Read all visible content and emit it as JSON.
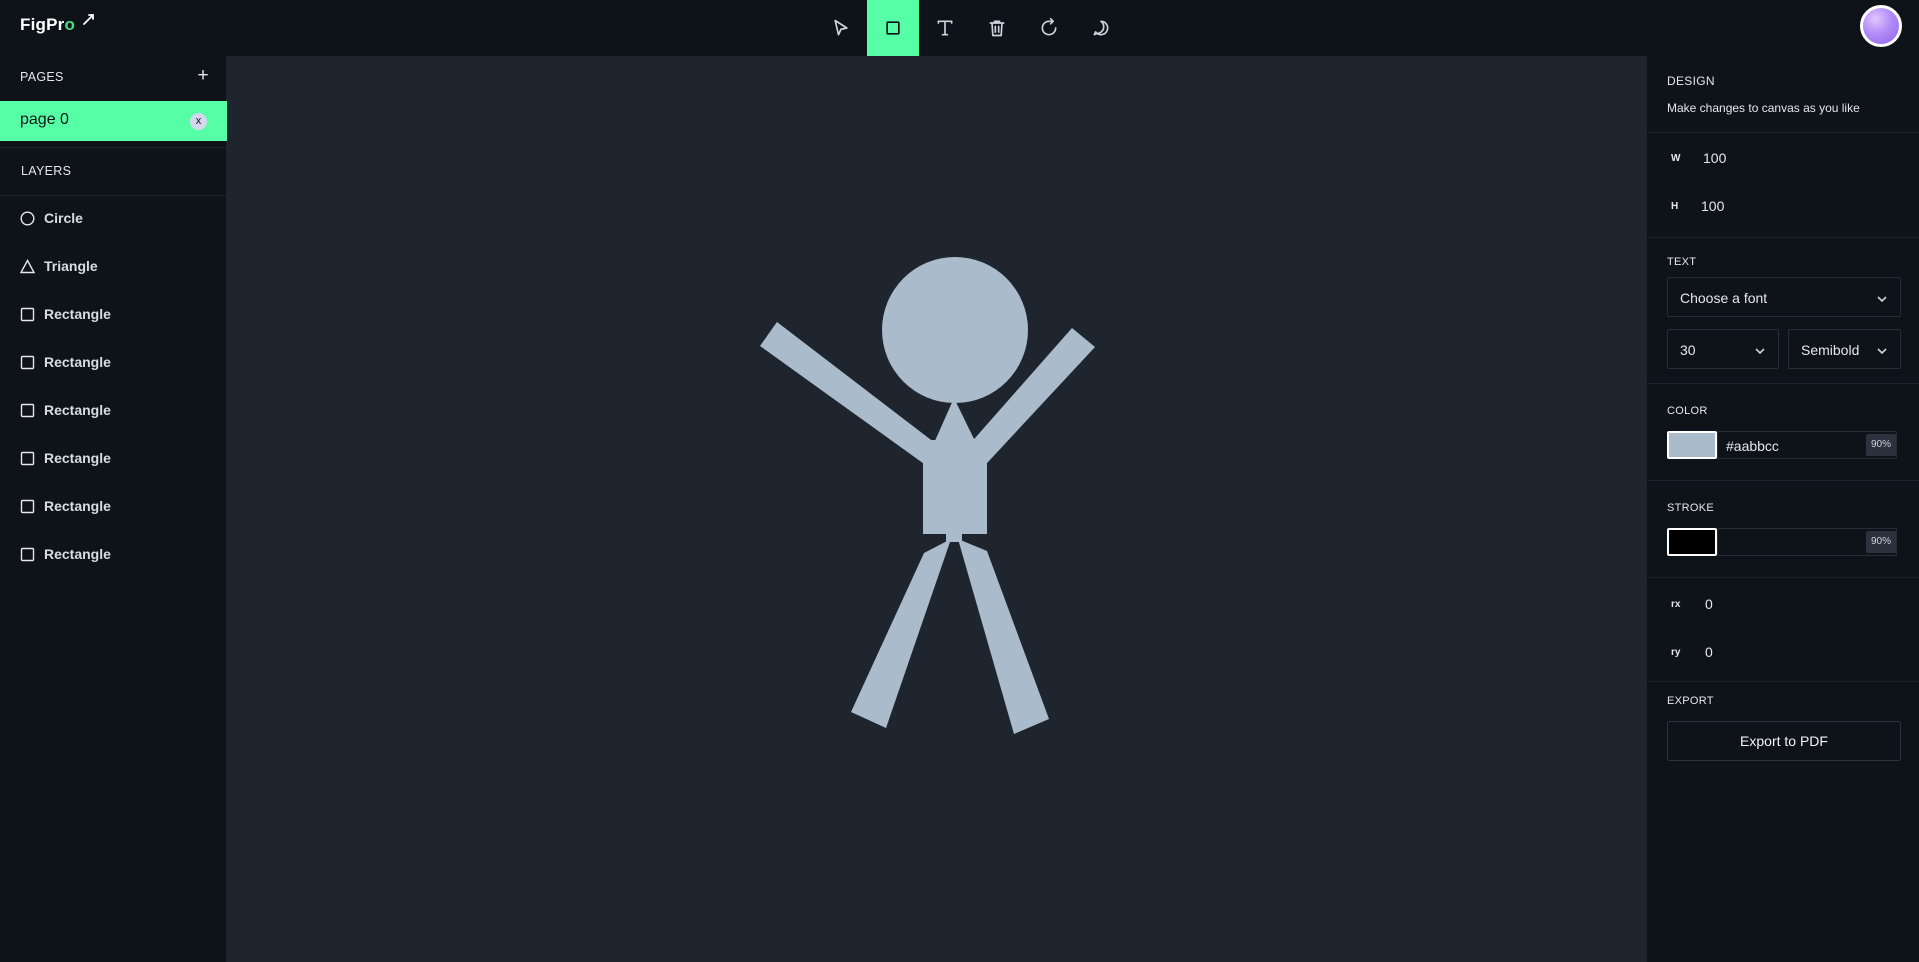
{
  "app": {
    "logo_main": "FigPr",
    "logo_accent": "o"
  },
  "toolbar": {
    "tools": [
      {
        "name": "select",
        "icon": "cursor-icon",
        "active": false
      },
      {
        "name": "rectangle",
        "icon": "square-icon",
        "active": true
      },
      {
        "name": "text",
        "icon": "text-icon",
        "active": false
      },
      {
        "name": "delete",
        "icon": "trash-icon",
        "active": false
      },
      {
        "name": "reset",
        "icon": "rotate-icon",
        "active": false
      },
      {
        "name": "comments",
        "icon": "comment-icon",
        "active": false
      }
    ]
  },
  "pages": {
    "heading": "PAGES",
    "add_label": "+",
    "items": [
      {
        "label": "page 0",
        "close_label": "x",
        "active": true
      }
    ]
  },
  "layers": {
    "heading": "LAYERS",
    "items": [
      {
        "label": "Circle",
        "icon": "circle-icon"
      },
      {
        "label": "Triangle",
        "icon": "triangle-icon"
      },
      {
        "label": "Rectangle",
        "icon": "rectangle-icon"
      },
      {
        "label": "Rectangle",
        "icon": "rectangle-icon"
      },
      {
        "label": "Rectangle",
        "icon": "rectangle-icon"
      },
      {
        "label": "Rectangle",
        "icon": "rectangle-icon"
      },
      {
        "label": "Rectangle",
        "icon": "rectangle-icon"
      },
      {
        "label": "Rectangle",
        "icon": "rectangle-icon"
      }
    ]
  },
  "design": {
    "heading": "DESIGN",
    "subtitle": "Make changes to canvas as you like",
    "w_label": "W",
    "w_value": "100",
    "h_label": "H",
    "h_value": "100"
  },
  "text": {
    "heading": "TEXT",
    "font_placeholder": "Choose a font",
    "size_value": "30",
    "weight_value": "Semibold"
  },
  "color": {
    "heading": "COLOR",
    "swatch": "#aabbcc",
    "hex": "#aabbcc",
    "opacity": "90%"
  },
  "stroke": {
    "heading": "STROKE",
    "swatch": "#000000",
    "hex": "",
    "opacity": "90%"
  },
  "radius": {
    "rx_label": "rx",
    "rx_value": "0",
    "ry_label": "ry",
    "ry_value": "0"
  },
  "export": {
    "heading": "EXPORT",
    "button_label": "Export to PDF"
  },
  "colors": {
    "accent": "#56ffa6",
    "figure": "#aabbcc",
    "canvas": "#1f252e",
    "panel": "#0e1319"
  }
}
